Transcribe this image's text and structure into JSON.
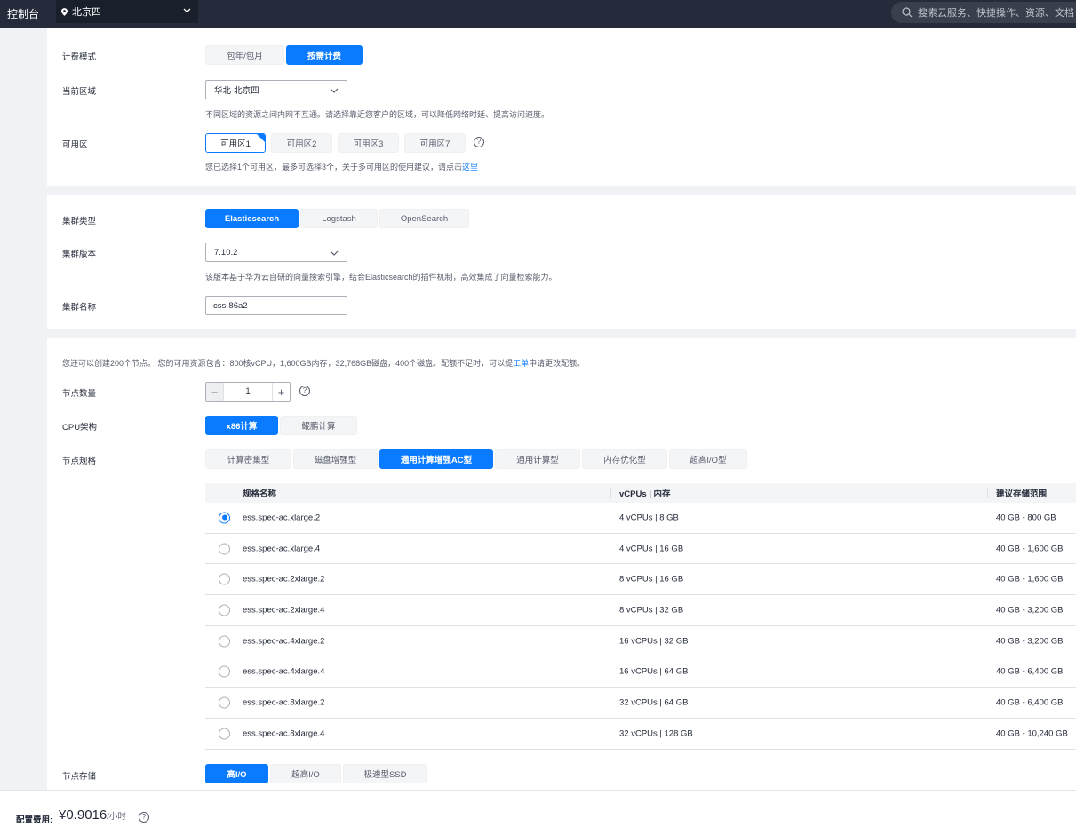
{
  "topbar": {
    "console_label": "控制台",
    "region": "北京四",
    "search_placeholder": "搜索云服务、快捷操作、资源、文档"
  },
  "billing": {
    "label": "计费模式",
    "options": [
      "包年/包月",
      "按需计费"
    ],
    "selected": "按需计费"
  },
  "region": {
    "label": "当前区域",
    "value": "华北-北京四",
    "hint": "不同区域的资源之间内网不互通。请选择靠近您客户的区域，可以降低网络时延、提高访问速度。"
  },
  "az": {
    "label": "可用区",
    "options": [
      "可用区1",
      "可用区2",
      "可用区3",
      "可用区7"
    ],
    "selected": "可用区1",
    "hint_prefix": "您已选择1个可用区，最多可选择3个，关于多可用区的使用建议，请点击",
    "hint_link": "这里"
  },
  "cluster_type": {
    "label": "集群类型",
    "options": [
      "Elasticsearch",
      "Logstash",
      "OpenSearch"
    ],
    "selected": "Elasticsearch"
  },
  "cluster_version": {
    "label": "集群版本",
    "value": "7.10.2",
    "hint": "该版本基于华为云自研的向量搜索引擎，结合Elasticsearch的插件机制，高效集成了向量检索能力。"
  },
  "cluster_name": {
    "label": "集群名称",
    "value": "css-86a2"
  },
  "quota": {
    "text_prefix": "您还可以创建200个节点。 您的可用资源包含：800核vCPU，1,600GB内存，32,768GB磁盘，400个磁盘。配额不足时，可以提",
    "link": "工单",
    "text_suffix": "申请更改配额。"
  },
  "node_count": {
    "label": "节点数量",
    "value": "1",
    "minus": "−",
    "plus": "+"
  },
  "cpu_arch": {
    "label": "CPU架构",
    "options": [
      "x86计算",
      "鲲鹏计算"
    ],
    "selected": "x86计算"
  },
  "node_spec": {
    "label": "节点规格",
    "tabs": [
      "计算密集型",
      "磁盘增强型",
      "通用计算增强AC型",
      "通用计算型",
      "内存优化型",
      "超高I/O型"
    ],
    "selected": "通用计算增强AC型",
    "columns": [
      "规格名称",
      "vCPUs | 内存",
      "建议存储范围"
    ],
    "rows": [
      {
        "name": "ess.spec-ac.xlarge.2",
        "cpu": "4 vCPUs | 8 GB",
        "range": "40 GB - 800 GB",
        "selected": true
      },
      {
        "name": "ess.spec-ac.xlarge.4",
        "cpu": "4 vCPUs | 16 GB",
        "range": "40 GB - 1,600 GB",
        "selected": false
      },
      {
        "name": "ess.spec-ac.2xlarge.2",
        "cpu": "8 vCPUs | 16 GB",
        "range": "40 GB - 1,600 GB",
        "selected": false
      },
      {
        "name": "ess.spec-ac.2xlarge.4",
        "cpu": "8 vCPUs | 32 GB",
        "range": "40 GB - 3,200 GB",
        "selected": false
      },
      {
        "name": "ess.spec-ac.4xlarge.2",
        "cpu": "16 vCPUs | 32 GB",
        "range": "40 GB - 3,200 GB",
        "selected": false
      },
      {
        "name": "ess.spec-ac.4xlarge.4",
        "cpu": "16 vCPUs | 64 GB",
        "range": "40 GB - 6,400 GB",
        "selected": false
      },
      {
        "name": "ess.spec-ac.8xlarge.2",
        "cpu": "32 vCPUs | 64 GB",
        "range": "40 GB - 6,400 GB",
        "selected": false
      },
      {
        "name": "ess.spec-ac.8xlarge.4",
        "cpu": "32 vCPUs | 128 GB",
        "range": "40 GB - 10,240 GB",
        "selected": false
      }
    ]
  },
  "storage": {
    "label": "节点存储",
    "options": [
      "高I/O",
      "超高I/O",
      "极速型SSD"
    ],
    "selected": "高I/O"
  },
  "footer": {
    "label": "配置费用:",
    "price": "¥0.9016",
    "unit": "/小时"
  },
  "colors": {
    "accent": "#0a7aff",
    "topbar": "#252b3a"
  }
}
